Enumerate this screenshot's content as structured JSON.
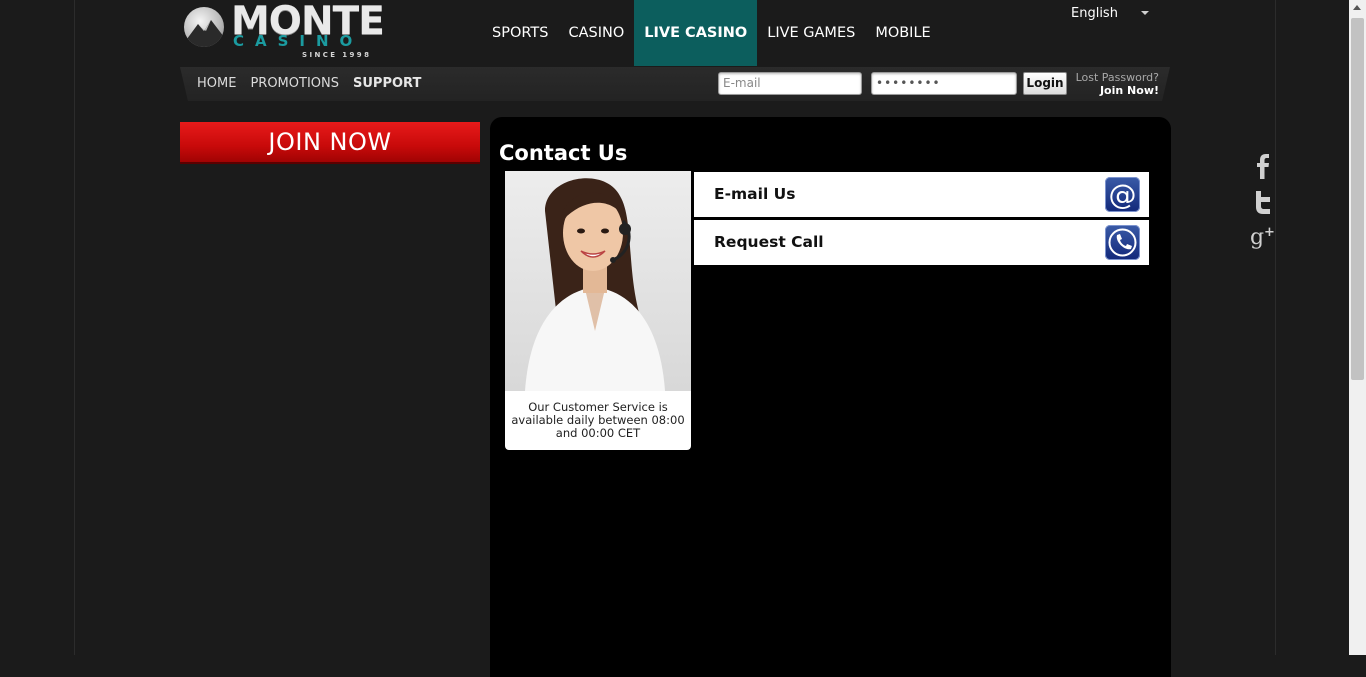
{
  "brand": {
    "name": "MONTE",
    "sub": "CASINO",
    "since": "SINCE 1998"
  },
  "main_nav": [
    {
      "label": "SPORTS",
      "active": false
    },
    {
      "label": "CASINO",
      "active": false
    },
    {
      "label": "LIVE CASINO",
      "active": true
    },
    {
      "label": "LIVE GAMES",
      "active": false
    },
    {
      "label": "MOBILE",
      "active": false
    }
  ],
  "language": {
    "selected": "English"
  },
  "sub_nav": [
    {
      "label": "HOME"
    },
    {
      "label": "PROMOTIONS"
    },
    {
      "label": "SUPPORT"
    }
  ],
  "login": {
    "email_placeholder": "E-mail",
    "password_value": "••••••••",
    "button": "Login",
    "lost_password": "Lost Password?",
    "join": "Join Now!"
  },
  "join_button": "JOIN NOW",
  "content": {
    "title": "Contact Us",
    "agent_text": "Our Customer Service is available daily between 08:00 and 00:00 CET",
    "options": [
      {
        "label": "E-mail Us",
        "icon": "at-sign-icon"
      },
      {
        "label": "Request Call",
        "icon": "phone-icon"
      }
    ]
  },
  "social": [
    "facebook-icon",
    "twitter-icon",
    "google-plus-icon"
  ],
  "colors": {
    "accent_teal": "#0c5e5d",
    "join_red": "#d01010",
    "panel": "#000000",
    "page_bg": "#1b1b1b"
  }
}
